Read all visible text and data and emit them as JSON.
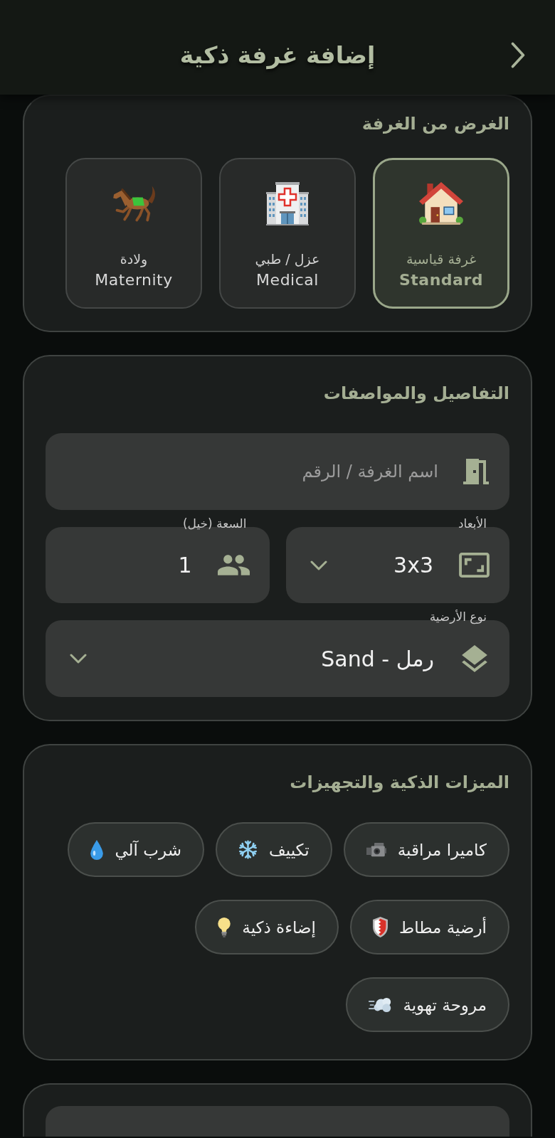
{
  "header": {
    "title": "إضافة غرفة ذكية"
  },
  "purpose": {
    "title": "الغرض من الغرفة",
    "options": [
      {
        "label": "غرفة قياسية",
        "sublabel": "Standard",
        "selected": true
      },
      {
        "label": "عزل / طبي",
        "sublabel": "Medical",
        "selected": false
      },
      {
        "label": "ولادة",
        "sublabel": "Maternity",
        "selected": false
      }
    ]
  },
  "details": {
    "title": "التفاصيل والمواصفات",
    "room_name": {
      "placeholder": "اسم الغرفة / الرقم"
    },
    "dimensions": {
      "label": "الأبعاد",
      "value": "3x3"
    },
    "capacity": {
      "label": "السعة (خيل)",
      "value": "1"
    },
    "floor_type": {
      "label": "نوع الأرضية",
      "value": "رمل - Sand"
    }
  },
  "features": {
    "title": "الميزات الذكية والتجهيزات",
    "items": [
      "كاميرا مراقبة",
      "تكييف",
      "شرب آلي",
      "أرضية مطاط",
      "إضاءة ذكية",
      "مروحة تهوية"
    ]
  }
}
